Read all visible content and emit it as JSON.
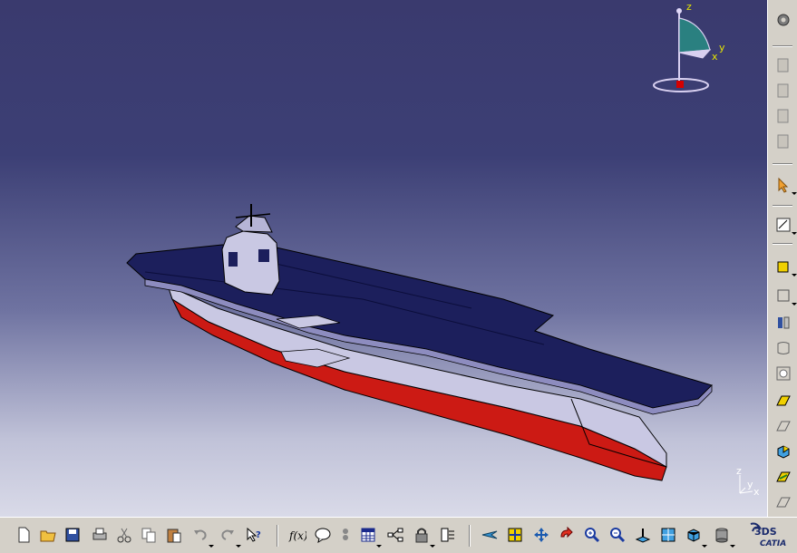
{
  "compass": {
    "z_label": "z",
    "x_label": "x",
    "y_label": "y"
  },
  "mini_axis": {
    "z_label": "z",
    "x_label": "x",
    "y_label": "y"
  },
  "logo": {
    "text": "CATIA",
    "mark": "3DS"
  },
  "colors": {
    "viewport_top": "#3a3a6e",
    "viewport_bottom": "#d9dae8",
    "deck": "#1c1f5c",
    "hull": "#cc1a14",
    "hull_upper": "#c9c8e3",
    "toolbar": "#d4d0c8"
  },
  "right_toolbar": {
    "items": [
      "gear-icon",
      "copy-icon",
      "copy-icon",
      "copy-icon",
      "copy-icon",
      "select-arrow-icon",
      "sketch-icon",
      "pad-icon",
      "pocket-icon",
      "shaft-icon",
      "groove-icon",
      "hole-icon",
      "rib-icon",
      "slot-icon",
      "solid-icon",
      "stiffener-icon"
    ]
  },
  "bottom_toolbar": {
    "items": [
      "new-icon",
      "open-icon",
      "save-icon",
      "print-icon",
      "cut-icon",
      "copy-icon",
      "paste-icon",
      "undo-icon",
      "redo-icon",
      "whats-this-icon",
      "formula-icon",
      "knowledge-icon",
      "balloon-icon",
      "table-icon",
      "graph-icon",
      "lock-icon",
      "catalog-icon",
      "fly-icon",
      "fit-all-icon",
      "pan-icon",
      "rotate-icon",
      "zoom-in-icon",
      "zoom-out-icon",
      "normal-view-icon",
      "multi-view-icon",
      "iso-view-icon",
      "shading-icon"
    ]
  }
}
